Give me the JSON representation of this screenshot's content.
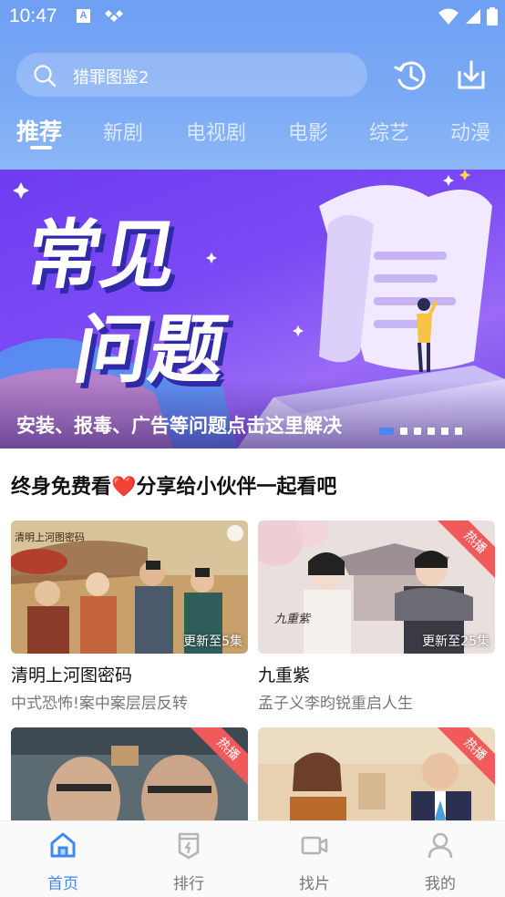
{
  "status_bar": {
    "time": "10:47",
    "app_icon_letter": "A"
  },
  "search": {
    "text": "猎罪图鉴2"
  },
  "tabs": [
    {
      "label": "推荐",
      "active": true
    },
    {
      "label": "新剧"
    },
    {
      "label": "电视剧"
    },
    {
      "label": "电影"
    },
    {
      "label": "综艺"
    },
    {
      "label": "动漫"
    }
  ],
  "banner": {
    "art_text_line1": "常见",
    "art_text_line2": "问题",
    "caption": "安装、报毒、广告等问题点击这里解决",
    "slide_count": 6,
    "active_slide": 1
  },
  "section": {
    "title": "终身免费看❤️分享给小伙伴一起看吧"
  },
  "cards": [
    {
      "title": "清明上河图密码",
      "subtitle": "中式恐怖!案中案层层反转",
      "update": "更新至5集",
      "hot": false,
      "poster_text": "清明上河图密码"
    },
    {
      "title": "九重紫",
      "subtitle": "孟子义李昀锐重启人生",
      "update": "更新至25集",
      "hot": true,
      "hot_label": "热播",
      "poster_text": "九重紫"
    },
    {
      "title": "",
      "subtitle": "",
      "update": "",
      "hot": true,
      "hot_label": "热播"
    },
    {
      "title": "",
      "subtitle": "",
      "update": "",
      "hot": true,
      "hot_label": "热播"
    }
  ],
  "nav": [
    {
      "label": "首页",
      "icon": "home-icon",
      "active": true
    },
    {
      "label": "排行",
      "icon": "ranking-icon"
    },
    {
      "label": "找片",
      "icon": "video-camera-icon"
    },
    {
      "label": "我的",
      "icon": "user-icon"
    }
  ],
  "colors": {
    "accent": "#3f88f3",
    "header": "#7aa9f5",
    "banner": "#7b49f4",
    "hot": "#f05a5a"
  }
}
